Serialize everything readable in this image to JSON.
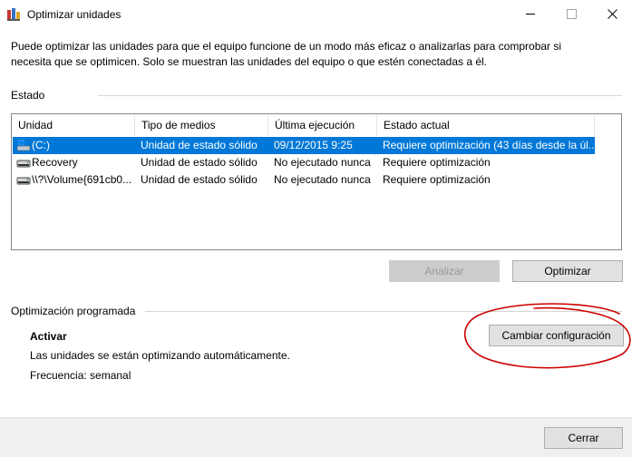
{
  "window": {
    "title": "Optimizar unidades",
    "minimize_glyph": "—",
    "close_glyph": "✕"
  },
  "description": "Puede optimizar las unidades para que el equipo funcione de un modo más eficaz o analizarlas para comprobar si necesita que se optimicen. Solo se muestran las unidades del equipo o que estén conectadas a él.",
  "status_section": {
    "label": "Estado",
    "columns": [
      "Unidad",
      "Tipo de medios",
      "Última ejecución",
      "Estado actual"
    ],
    "rows": [
      {
        "drive": "(C:)",
        "media_type": "Unidad de estado sólido",
        "last_run": "09/12/2015 9:25",
        "status": "Requiere optimización (43 días desde la úl...",
        "selected": true,
        "icon": "windows-drive-icon"
      },
      {
        "drive": "Recovery",
        "media_type": "Unidad de estado sólido",
        "last_run": "No ejecutado nunca",
        "status": "Requiere optimización",
        "selected": false,
        "icon": "drive-icon"
      },
      {
        "drive": "\\\\?\\Volume{691cb0...",
        "media_type": "Unidad de estado sólido",
        "last_run": "No ejecutado nunca",
        "status": "Requiere optimización",
        "selected": false,
        "icon": "drive-icon"
      }
    ],
    "analyze_button": "Analizar",
    "optimize_button": "Optimizar"
  },
  "scheduled_section": {
    "label": "Optimización programada",
    "state": "Activar",
    "info": "Las unidades se están optimizando automáticamente.",
    "frequency": "Frecuencia: semanal",
    "change_settings_button": "Cambiar configuración"
  },
  "footer": {
    "close_button": "Cerrar"
  },
  "colors": {
    "selection": "#0078d7",
    "annotation": "#cc0000"
  }
}
